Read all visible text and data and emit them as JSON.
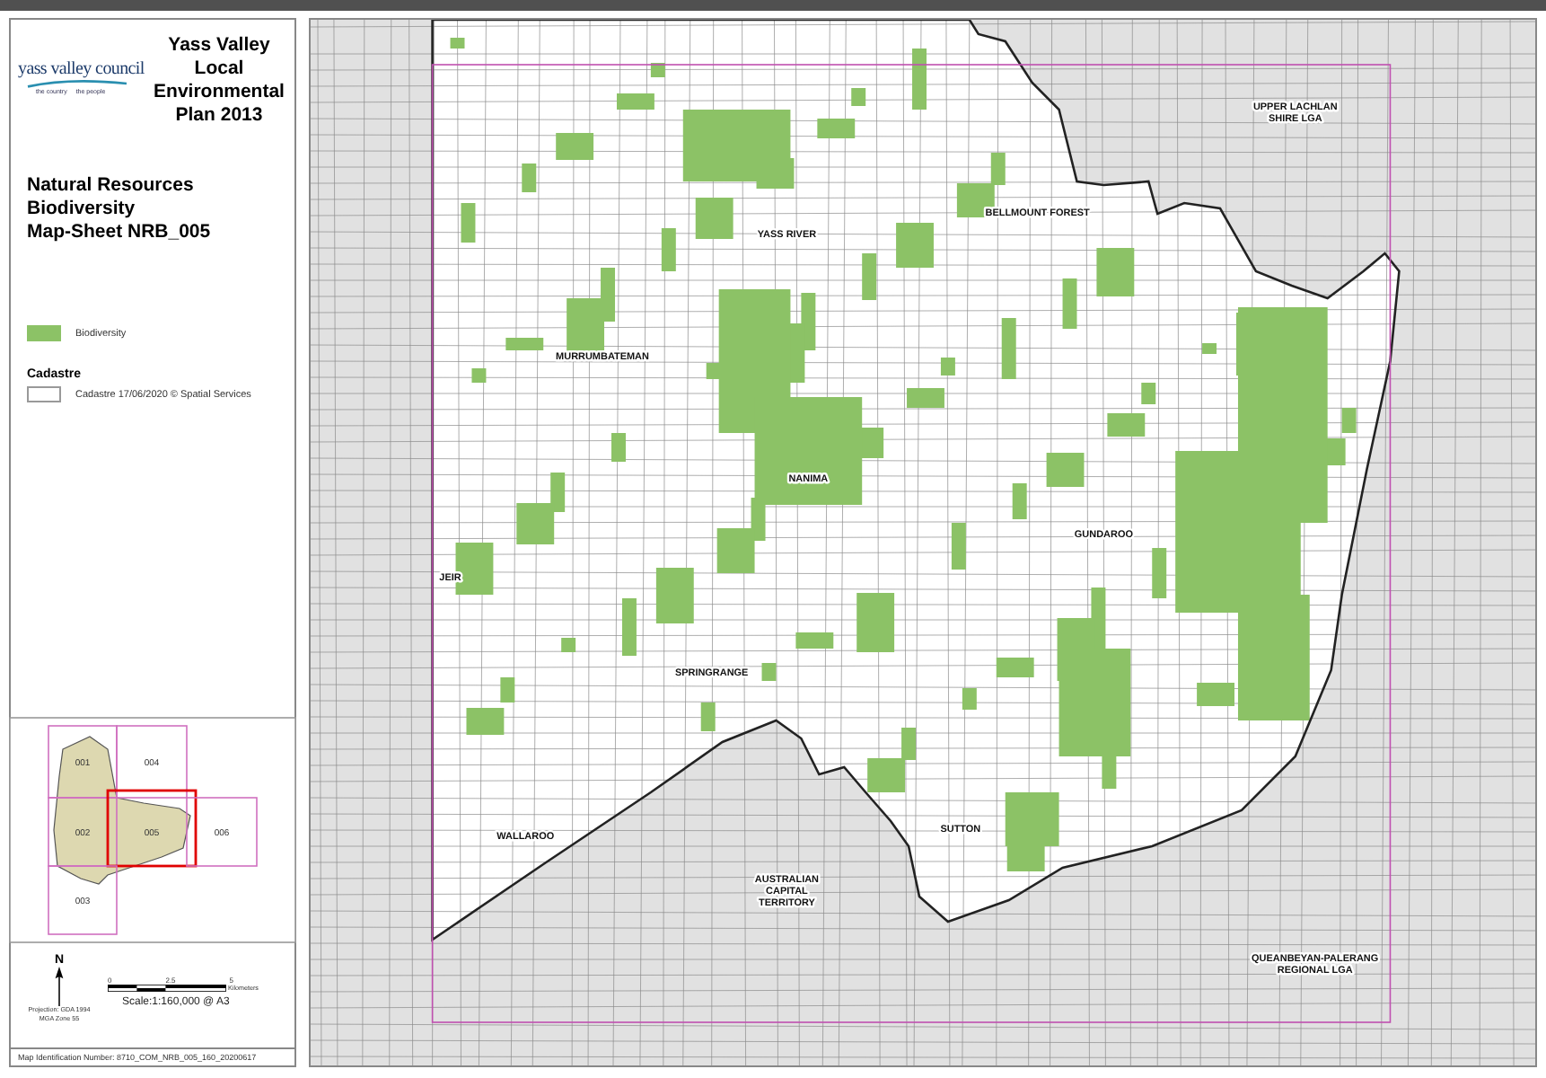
{
  "logo": {
    "name": "yass valley council",
    "tagline": [
      "the country",
      "the people"
    ]
  },
  "plan_title": "Yass Valley Local Environmental Plan 2013",
  "map_title": [
    "Natural Resources Biodiversity",
    "Map-Sheet NRB_005"
  ],
  "legend": [
    {
      "kind": "fill",
      "color": "#8cc266",
      "label": "Biodiversity"
    },
    {
      "kind": "heading",
      "label": "Cadastre"
    },
    {
      "kind": "outline",
      "label": "Cadastre 17/06/2020 © Spatial Services"
    }
  ],
  "key_map": {
    "sheets": [
      {
        "label": "001",
        "selected": false
      },
      {
        "label": "004",
        "selected": false
      },
      {
        "label": "002",
        "selected": false
      },
      {
        "label": "005",
        "selected": true
      },
      {
        "label": "006",
        "selected": false
      },
      {
        "label": "003",
        "selected": false
      }
    ]
  },
  "north_arrow": {
    "label": "N"
  },
  "projection": [
    "Projection: GDA 1994",
    "MGA Zone 55"
  ],
  "scale_bar": {
    "ticks": [
      "0",
      "2.5",
      "5"
    ],
    "unit": "Kilometers",
    "text": "Scale:1:160,000 @ A3"
  },
  "map_id": "Map Identification Number: 8710_COM_NRB_005_160_20200617",
  "map_labels": [
    {
      "lines": [
        "UPPER LACHLAN",
        "SHIRE LGA"
      ]
    },
    {
      "lines": [
        "BELLMOUNT FOREST"
      ]
    },
    {
      "lines": [
        "YASS RIVER"
      ]
    },
    {
      "lines": [
        "MURRUMBATEMAN"
      ]
    },
    {
      "lines": [
        "NANIMA"
      ]
    },
    {
      "lines": [
        "GUNDAROO"
      ]
    },
    {
      "lines": [
        "JEIR"
      ]
    },
    {
      "lines": [
        "SPRINGRANGE"
      ]
    },
    {
      "lines": [
        "WALLAROO"
      ]
    },
    {
      "lines": [
        "SUTTON"
      ]
    },
    {
      "lines": [
        "AUSTRALIAN",
        "CAPITAL",
        "TERRITORY"
      ]
    },
    {
      "lines": [
        "QUEANBEYAN-PALERANG",
        "REGIONAL LGA"
      ]
    }
  ]
}
